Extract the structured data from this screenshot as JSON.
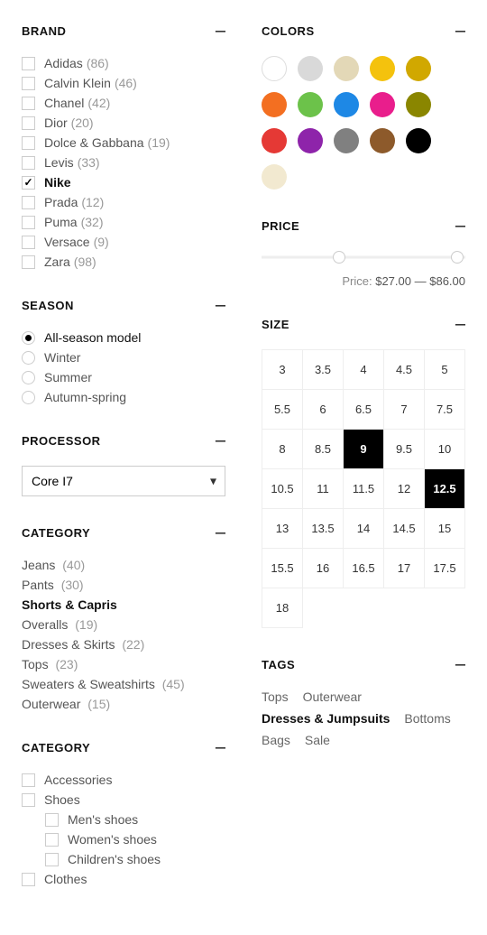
{
  "brand": {
    "title": "BRAND",
    "items": [
      {
        "label": "Adidas",
        "count": "(86)",
        "checked": false
      },
      {
        "label": "Calvin Klein",
        "count": "(46)",
        "checked": false
      },
      {
        "label": "Chanel",
        "count": "(42)",
        "checked": false
      },
      {
        "label": "Dior",
        "count": "(20)",
        "checked": false
      },
      {
        "label": "Dolce & Gabbana",
        "count": "(19)",
        "checked": false
      },
      {
        "label": "Levis",
        "count": "(33)",
        "checked": false
      },
      {
        "label": "Nike",
        "count": "",
        "checked": true
      },
      {
        "label": "Prada",
        "count": "(12)",
        "checked": false
      },
      {
        "label": "Puma",
        "count": "(32)",
        "checked": false
      },
      {
        "label": "Versace",
        "count": "(9)",
        "checked": false
      },
      {
        "label": "Zara",
        "count": "(98)",
        "checked": false
      }
    ]
  },
  "season": {
    "title": "SEASON",
    "items": [
      {
        "label": "All-season model",
        "checked": true
      },
      {
        "label": "Winter",
        "checked": false
      },
      {
        "label": "Summer",
        "checked": false
      },
      {
        "label": "Autumn-spring",
        "checked": false
      }
    ]
  },
  "processor": {
    "title": "PROCESSOR",
    "selected": "Core I7"
  },
  "category1": {
    "title": "CATEGORY",
    "items": [
      {
        "label": "Jeans",
        "count": "(40)",
        "selected": false
      },
      {
        "label": "Pants",
        "count": "(30)",
        "selected": false
      },
      {
        "label": "Shorts & Capris",
        "count": "",
        "selected": true
      },
      {
        "label": "Overalls",
        "count": "(19)",
        "selected": false
      },
      {
        "label": "Dresses & Skirts",
        "count": "(22)",
        "selected": false
      },
      {
        "label": "Tops",
        "count": "(23)",
        "selected": false
      },
      {
        "label": "Sweaters & Sweatshirts",
        "count": "(45)",
        "selected": false
      },
      {
        "label": "Outerwear",
        "count": "(15)",
        "selected": false
      }
    ]
  },
  "category2": {
    "title": "CATEGORY",
    "items": [
      {
        "label": "Accessories",
        "children": []
      },
      {
        "label": "Shoes",
        "children": [
          {
            "label": "Men's shoes"
          },
          {
            "label": "Women's shoes"
          },
          {
            "label": "Children's shoes"
          }
        ]
      },
      {
        "label": "Clothes",
        "children": []
      }
    ]
  },
  "colors": {
    "title": "COLORS",
    "swatches": [
      {
        "c": "#ffffff",
        "bordered": true
      },
      {
        "c": "#d9d9d9"
      },
      {
        "c": "#e3d8b7"
      },
      {
        "c": "#f4c20d"
      },
      {
        "c": "#d1a800"
      },
      {
        "c": "#f36f21"
      },
      {
        "c": "#6cc24a"
      },
      {
        "c": "#1e88e5"
      },
      {
        "c": "#e91e8c"
      },
      {
        "c": "#8a8600"
      },
      {
        "c": "#e53935"
      },
      {
        "c": "#8e24aa"
      },
      {
        "c": "#808080"
      },
      {
        "c": "#8d5a2b"
      },
      {
        "c": "#000000"
      },
      {
        "c": "#f2e9d0"
      }
    ]
  },
  "price": {
    "title": "PRICE",
    "label": "Price:",
    "min": "$27.00",
    "dash": "—",
    "max": "$86.00"
  },
  "size": {
    "title": "SIZE",
    "cells": [
      {
        "v": "3"
      },
      {
        "v": "3.5"
      },
      {
        "v": "4"
      },
      {
        "v": "4.5"
      },
      {
        "v": "5"
      },
      {
        "v": "5.5"
      },
      {
        "v": "6"
      },
      {
        "v": "6.5"
      },
      {
        "v": "7"
      },
      {
        "v": "7.5"
      },
      {
        "v": "8"
      },
      {
        "v": "8.5"
      },
      {
        "v": "9",
        "sel": true
      },
      {
        "v": "9.5"
      },
      {
        "v": "10"
      },
      {
        "v": "10.5"
      },
      {
        "v": "11"
      },
      {
        "v": "11.5"
      },
      {
        "v": "12"
      },
      {
        "v": "12.5",
        "sel": true
      },
      {
        "v": "13"
      },
      {
        "v": "13.5"
      },
      {
        "v": "14"
      },
      {
        "v": "14.5"
      },
      {
        "v": "15"
      },
      {
        "v": "15.5"
      },
      {
        "v": "16"
      },
      {
        "v": "16.5"
      },
      {
        "v": "17"
      },
      {
        "v": "17.5"
      },
      {
        "v": "18"
      }
    ]
  },
  "tags": {
    "title": "TAGS",
    "items": [
      {
        "label": "Tops"
      },
      {
        "label": "Outerwear"
      },
      {
        "label": "Dresses & Jumpsuits",
        "sel": true
      },
      {
        "label": "Bottoms"
      },
      {
        "label": "Bags"
      },
      {
        "label": "Sale"
      }
    ]
  },
  "collapse": "–"
}
